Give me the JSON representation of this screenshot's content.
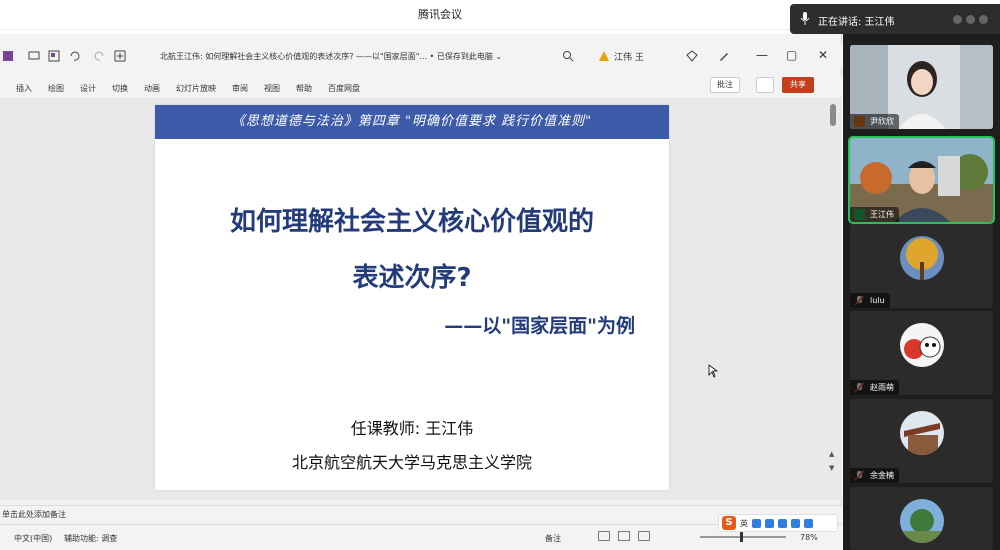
{
  "meeting": {
    "app_title": "腾讯会议",
    "speaking_label": "正在讲话: 王江伟"
  },
  "ppt": {
    "doc_title": "北航王江伟: 如何理解社会主义核心价值观的表述次序? ——以\"国家层面\"... • 已保存到此电脑 ⌄",
    "user_name": "江伟 王",
    "ribbon_tabs": [
      "插入",
      "绘图",
      "设计",
      "切换",
      "动画",
      "幻灯片放映",
      "审阅",
      "视图",
      "帮助",
      "百度网盘"
    ],
    "comment_label": "批注",
    "share_label": "共享",
    "notes_placeholder": "单击此处添加备注",
    "status": {
      "language": "中文(中国)",
      "accessibility": "辅助功能: 调查",
      "notes_label": "备注",
      "zoom": "78%"
    },
    "ime_label": "英"
  },
  "slide": {
    "header": "《思想道德与法治》第四章 \"明确价值要求 践行价值准则\"",
    "title_line1": "如何理解社会主义核心价值观的",
    "title_line2": "表述次序?",
    "subtitle": "——以\"国家层面\"为例",
    "teacher": "任课教师: 王江伟",
    "institution": "北京航空航天大学马克思主义学院",
    "colors": {
      "header_bg": "#3d5ba9",
      "title": "#233b7a"
    }
  },
  "participants": [
    {
      "name": "尹欣欣",
      "type": "video",
      "icon": "person-video"
    },
    {
      "name": "王江伟",
      "type": "video",
      "icon": "person-video",
      "active": true
    },
    {
      "name": "lulu",
      "type": "avatar",
      "icon": "autumn-tree-avatar"
    },
    {
      "name": "赵雨萌",
      "type": "avatar",
      "icon": "cartoon-avatar"
    },
    {
      "name": "余金楠",
      "type": "avatar",
      "icon": "building-avatar"
    },
    {
      "name": "",
      "type": "avatar",
      "icon": "scenery-avatar"
    }
  ]
}
